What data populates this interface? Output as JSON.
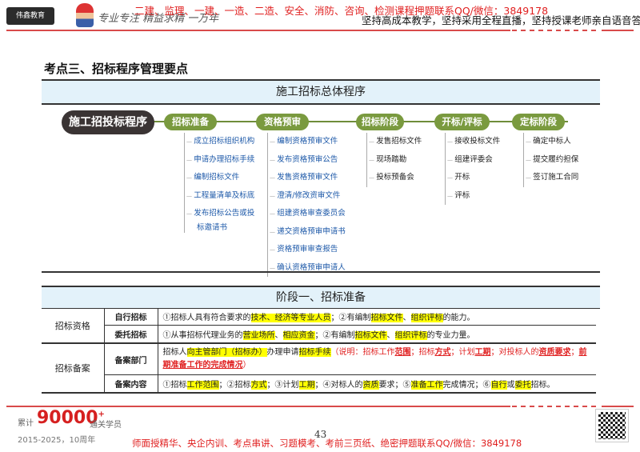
{
  "header": {
    "logo": "伟鑫教育",
    "slogan": "专业专注 精益求精 一万年",
    "promo": "二建、监理、一建、一造、二造、安全、消防、咨询、检测课程押题联系QQ/微信：3849178",
    "tagline": "坚持高成本教学，坚持采用全程直播，坚持授课老师亲自语音答疑"
  },
  "title": "考点三、招标程序管理要点",
  "section1": {
    "heading": "施工招标总体程序",
    "main": "施工招投标程序",
    "stages": [
      {
        "label": "招标准备",
        "items": [
          "成立招标组织机构",
          "申请办理招标手续",
          "编制招标文件",
          "工程量清单及标底",
          "发布招标公告或投",
          "标邀请书"
        ]
      },
      {
        "label": "资格预审",
        "items": [
          "编制资格预审文件",
          "发布资格预审公告",
          "发售资格预审文件",
          "澄清/修改资审文件",
          "组建资格审查委员会",
          "递交资格预审申请书",
          "资格预审审查报告",
          "确认资格预审申请人"
        ]
      },
      {
        "label": "招标阶段",
        "items": [
          "发售招标文件",
          "现场踏勘",
          "投标预备会"
        ]
      },
      {
        "label": "开标/评标",
        "items": [
          "接收投标文件",
          "组建评委会",
          "开标",
          "评标"
        ]
      },
      {
        "label": "定标阶段",
        "items": [
          "确定中标人",
          "提交履约担保",
          "签订施工合同"
        ]
      }
    ]
  },
  "section2": {
    "heading": "阶段一、招标准备",
    "groups": [
      "招标资格",
      "招标备案"
    ],
    "rows": [
      {
        "label": "自行招标",
        "segs": [
          [
            "①招标人具有符合要求的",
            ""
          ],
          [
            "技术、经济等专业人员",
            "hl"
          ],
          [
            "；②有编制",
            ""
          ],
          [
            "招标文件",
            "hl"
          ],
          [
            "、",
            ""
          ],
          [
            "组织评标",
            "hl"
          ],
          [
            "的能力。",
            ""
          ]
        ]
      },
      {
        "label": "委托招标",
        "segs": [
          [
            "①从事招标代理业务的",
            ""
          ],
          [
            "营业场所",
            "hl"
          ],
          [
            "、",
            ""
          ],
          [
            "相应资金",
            "hl"
          ],
          [
            "；②有编制",
            ""
          ],
          [
            "招标文件",
            "hl"
          ],
          [
            "、",
            ""
          ],
          [
            "组织评标",
            "hl"
          ],
          [
            "的专业力量。",
            ""
          ]
        ]
      },
      {
        "label": "备案部门",
        "segs": [
          [
            "招标人",
            ""
          ],
          [
            "向主管部门（招标办）",
            "hl"
          ],
          [
            "办理申请",
            ""
          ],
          [
            "招标手续",
            "hl"
          ],
          [
            "（说明：招标工作",
            ""
          ],
          [
            "范围",
            "rdu"
          ],
          [
            "；招标",
            ""
          ],
          [
            "方式",
            "rdu"
          ],
          [
            "；计划",
            ""
          ],
          [
            "工期",
            "rdu"
          ],
          [
            "；对投标人的",
            ""
          ],
          [
            "资质要求",
            "rdu"
          ],
          [
            "；",
            ""
          ],
          [
            "前期准备工作的完成情况",
            "rdu"
          ],
          [
            "）",
            ""
          ]
        ],
        "note_red": true
      },
      {
        "label": "备案内容",
        "segs": [
          [
            "①招标",
            ""
          ],
          [
            "工作范围",
            "hl"
          ],
          [
            "；②招标",
            ""
          ],
          [
            "方式",
            "hl"
          ],
          [
            "；③计划",
            ""
          ],
          [
            "工期",
            "hl"
          ],
          [
            "；④对标人的",
            ""
          ],
          [
            "资质",
            "hl"
          ],
          [
            "要求；⑤",
            ""
          ],
          [
            "准备工作",
            "hl"
          ],
          [
            "完成情况；⑥",
            ""
          ],
          [
            "自行",
            "hl"
          ],
          [
            "或",
            ""
          ],
          [
            "委托",
            "hl"
          ],
          [
            "招标。",
            ""
          ]
        ]
      }
    ]
  },
  "footer": {
    "left_label": "累计",
    "count": "90000",
    "count_sup": "+",
    "right_label": "通关学员",
    "years": "2015-2025，10周年",
    "page": "43",
    "promo": "师面授精华、央企内训、考点串讲、习题模考、考前三页纸、绝密押题联系QQ/微信：3849178"
  }
}
